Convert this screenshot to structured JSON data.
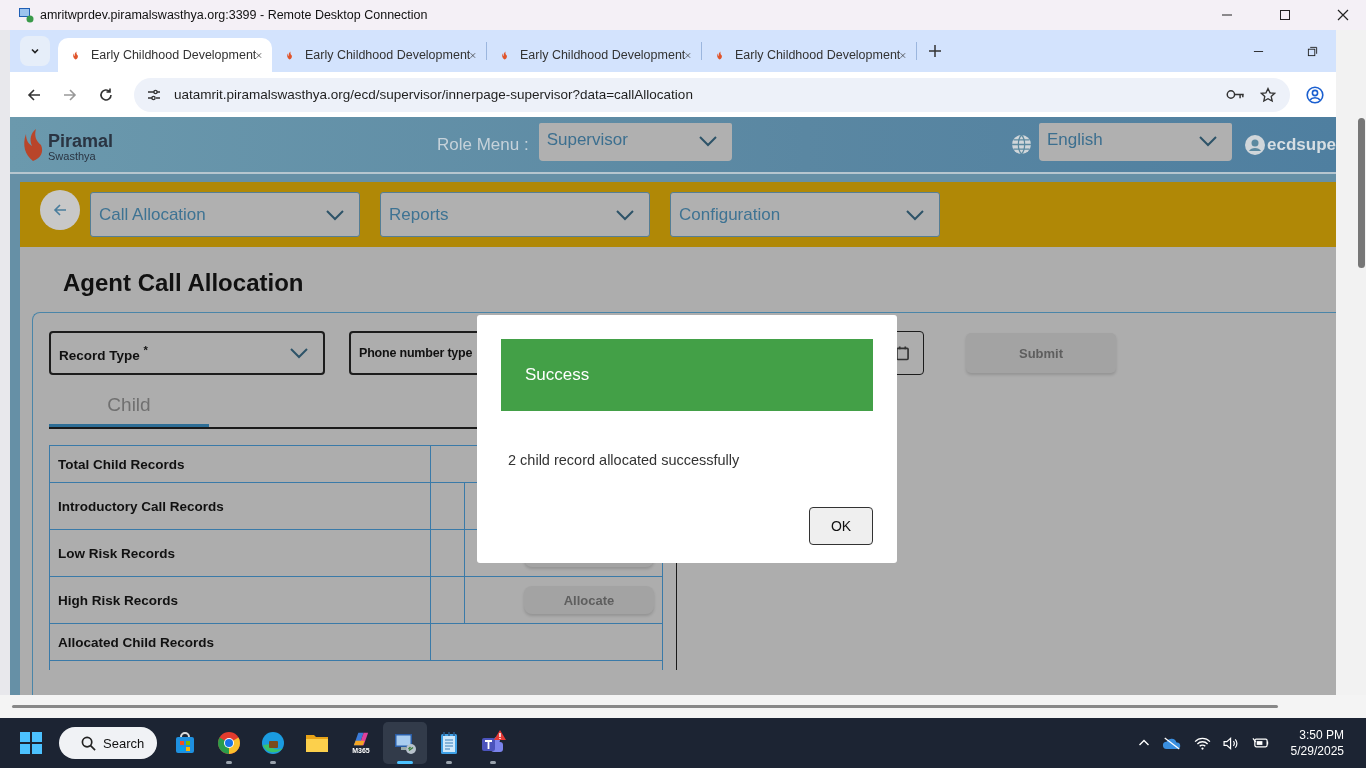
{
  "window": {
    "title": "amritwprdev.piramalswasthya.org:3399 - Remote Desktop Connection"
  },
  "browser": {
    "tabs": [
      {
        "title": "Early Childhood Development",
        "selected": true
      },
      {
        "title": "Early Childhood Development",
        "selected": false
      },
      {
        "title": "Early Childhood Development",
        "selected": false
      },
      {
        "title": "Early Childhood Development",
        "selected": false
      }
    ],
    "url": "uatamrit.piramalswasthya.org/ecd/supervisor/innerpage-supervisor?data=callAllocation"
  },
  "header": {
    "logo_name": "Piramal",
    "logo_sub": "Swasthya",
    "role_label": "Role Menu :",
    "role": "Supervisor",
    "language": "English",
    "user": "ecdsupe"
  },
  "nav": [
    "Call Allocation",
    "Reports",
    "Configuration"
  ],
  "page_title": "Agent Call Allocation",
  "filters": {
    "record_type": "Record Type $^{*}$",
    "phone_type": "Phone number type",
    "submit": "Submit"
  },
  "record_tabs": [
    {
      "label": "Child",
      "selected": true
    }
  ],
  "table": {
    "rows": [
      {
        "label": "Total Child Records",
        "kind": "plain"
      },
      {
        "label": "Introductory Call Records",
        "kind": "split"
      },
      {
        "label": "Low Risk Records",
        "kind": "covered"
      },
      {
        "label": "High Risk Records",
        "kind": "button",
        "button": "Allocate"
      },
      {
        "label": "Allocated Child Records",
        "kind": "plain"
      }
    ]
  },
  "dialog": {
    "title": "Success",
    "message": "2 child record allocated successfully",
    "ok": "OK"
  },
  "taskbar": {
    "search": "Search",
    "apps": [
      {
        "kind": "store",
        "running": false,
        "selected": false
      },
      {
        "kind": "chrome",
        "running": true,
        "selected": false
      },
      {
        "kind": "edge",
        "running": true,
        "selected": false
      },
      {
        "kind": "files",
        "running": false,
        "selected": false
      },
      {
        "kind": "m365",
        "label": "M365",
        "running": false,
        "selected": false
      },
      {
        "kind": "rdp",
        "running": true,
        "selected": true
      },
      {
        "kind": "notepad",
        "running": true,
        "selected": false
      },
      {
        "kind": "teams",
        "running": true,
        "selected": false
      }
    ],
    "time": "3:50 PM",
    "date": "5/29/2025"
  }
}
